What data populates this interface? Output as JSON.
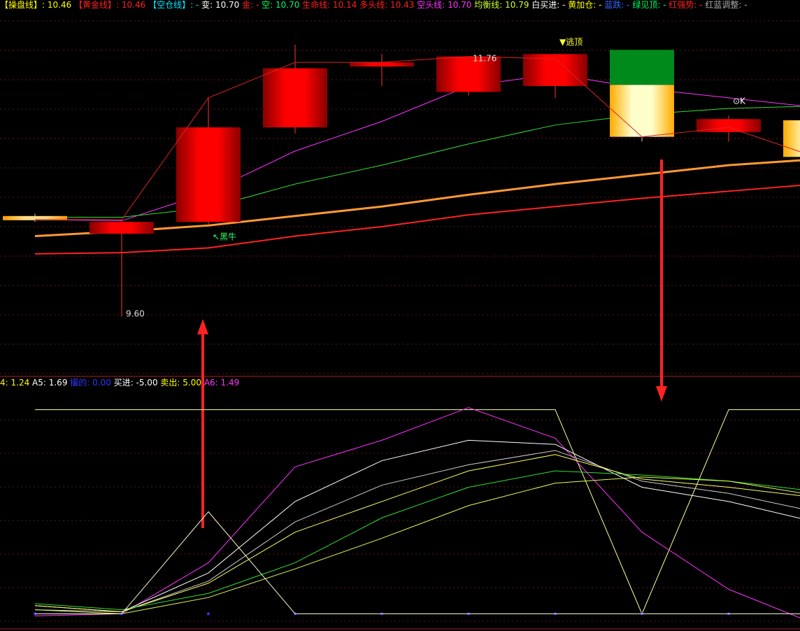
{
  "top_legend": [
    {
      "text": "【操盘线】: 10.46",
      "color": "#ffff00"
    },
    {
      "text": " 【黄金线】: 10.46",
      "color": "#ff2020"
    },
    {
      "text": " 【空仓线】: -",
      "color": "#00e5ff"
    },
    {
      "text": " 变: 10.70",
      "color": "#ffffff"
    },
    {
      "text": " 金: -",
      "color": "#ff2020"
    },
    {
      "text": " 空: 10.70",
      "color": "#00ff66"
    },
    {
      "text": "  生命线: 10.14",
      "color": "#ff2020"
    },
    {
      "text": "  多头线: 10.43",
      "color": "#ff2020"
    },
    {
      "text": " 空头线: 10.70",
      "color": "#ff33ff"
    },
    {
      "text": " 均衡线: 10.79",
      "color": "#ccff33"
    },
    {
      "text": "    白买进: -",
      "color": "#ffffff"
    },
    {
      "text": " 黄加仓: -",
      "color": "#ffff00"
    },
    {
      "text": " 蓝跌: -",
      "color": "#3366ff"
    },
    {
      "text": " 绿见顶: -",
      "color": "#00ff66"
    },
    {
      "text": " 红强势: -",
      "color": "#ff2020"
    },
    {
      "text": " 红蓝调整: -",
      "color": "#aaaaaa"
    }
  ],
  "bottom_legend": [
    {
      "text": "4: 1.24",
      "color": "#ffff00"
    },
    {
      "text": "  A5: 1.69",
      "color": "#ffffff"
    },
    {
      "text": "  撮的: 0.00",
      "color": "#3333ff"
    },
    {
      "text": "  买进: -5.00",
      "color": "#ffffff"
    },
    {
      "text": "  卖出: 5.00",
      "color": "#ffff00"
    },
    {
      "text": "  A6: 1.49",
      "color": "#ff33ff"
    }
  ],
  "chart_data": [
    {
      "type": "candlestick",
      "panel": "price",
      "ylim": [
        9.2,
        12.1
      ],
      "x_count": 10,
      "candles": [
        {
          "open": 10.45,
          "close": 10.42,
          "high": 10.47,
          "low": 10.4,
          "color": "#ffcc33"
        },
        {
          "open": 10.4,
          "close": 10.3,
          "high": 10.42,
          "low": 9.6,
          "color": "#ff0000"
        },
        {
          "open": 10.4,
          "close": 11.2,
          "high": 11.45,
          "low": 10.38,
          "color": "#ff0000"
        },
        {
          "open": 11.2,
          "close": 11.7,
          "high": 11.9,
          "low": 11.15,
          "color": "#ff0000"
        },
        {
          "open": 11.72,
          "close": 11.75,
          "high": 11.82,
          "low": 11.55,
          "color": "#ff0000"
        },
        {
          "open": 11.5,
          "close": 11.8,
          "high": 11.76,
          "low": 11.47,
          "color": "#ff0000"
        },
        {
          "open": 11.82,
          "close": 11.55,
          "high": 11.82,
          "low": 11.45,
          "color": "#ff0000"
        },
        {
          "open": 11.56,
          "close": 11.12,
          "high": 11.82,
          "low": 11.08,
          "color": "#ffee55",
          "top_color": "#008a1c"
        },
        {
          "open": 11.27,
          "close": 11.16,
          "high": 11.3,
          "low": 11.08,
          "color": "#ff0000"
        },
        {
          "open": 11.26,
          "close": 10.95,
          "high": 11.26,
          "low": 10.9,
          "color": "#ffee55"
        }
      ],
      "lines": [
        {
          "name": "magenta",
          "color": "#ff33ff",
          "values": [
            10.42,
            10.41,
            10.65,
            11.0,
            11.25,
            11.55,
            11.65,
            11.53,
            11.45,
            11.37
          ]
        },
        {
          "name": "green",
          "color": "#33dd33",
          "values": [
            10.44,
            10.44,
            10.52,
            10.72,
            10.88,
            11.06,
            11.22,
            11.31,
            11.36,
            11.38
          ]
        },
        {
          "name": "orange",
          "color": "#ff9933",
          "values": [
            10.28,
            10.32,
            10.37,
            10.45,
            10.53,
            10.63,
            10.72,
            10.8,
            10.88,
            10.93
          ]
        },
        {
          "name": "red",
          "color": "#ff2222",
          "values": [
            10.13,
            10.14,
            10.18,
            10.28,
            10.36,
            10.46,
            10.53,
            10.6,
            10.66,
            10.72
          ]
        },
        {
          "name": "close-link",
          "color": "#dd2222",
          "values": [
            10.42,
            10.42,
            11.45,
            11.75,
            11.75,
            11.8,
            11.78,
            11.12,
            11.2,
            10.95
          ]
        }
      ],
      "annotations": [
        {
          "text": "11.76",
          "index": 5,
          "value": 11.76,
          "color": "#dddddd"
        },
        {
          "text": "9.60",
          "index": 1,
          "value": 9.6,
          "color": "#dddddd"
        },
        {
          "text": "▼逃顶",
          "index": 6,
          "value": 11.9,
          "color": "#ffff33"
        },
        {
          "text": "↖黑牛",
          "index": 2,
          "value": 10.25,
          "color": "#33ff66"
        },
        {
          "text": "⊙K",
          "index": 8,
          "value": 11.4,
          "color": "#ffffff"
        }
      ],
      "arrows": [
        {
          "index": 2,
          "direction": "up",
          "color": "#ff2222"
        },
        {
          "index": 7,
          "direction": "down",
          "color": "#ff2222"
        }
      ]
    },
    {
      "type": "line",
      "panel": "indicator",
      "ylim": [
        -5.5,
        5.5
      ],
      "series": [
        {
          "name": "买进",
          "color": "#ffff99",
          "values": [
            5.0,
            5.0,
            5.0,
            5.0,
            5.0,
            5.0,
            5.0,
            -5.0,
            5.0,
            5.0
          ]
        },
        {
          "name": "magenta-line",
          "color": "#ff33ff",
          "values": [
            -5.1,
            -5.0,
            -2.5,
            2.2,
            3.5,
            5.1,
            3.6,
            -1.0,
            -3.8,
            -5.5
          ]
        },
        {
          "name": "white-a",
          "color": "#ffffff",
          "values": [
            -4.6,
            -4.9,
            -3.0,
            0.5,
            2.5,
            3.5,
            3.3,
            1.2,
            0.5,
            -0.5
          ]
        },
        {
          "name": "white-b",
          "color": "#cccccc",
          "values": [
            -4.8,
            -4.9,
            -3.4,
            -0.5,
            1.3,
            2.3,
            3.0,
            1.5,
            0.9,
            0.0
          ]
        },
        {
          "name": "yellow-line",
          "color": "#ffff66",
          "values": [
            -4.6,
            -4.9,
            -3.5,
            -1.0,
            0.5,
            2.0,
            2.8,
            1.6,
            1.2,
            0.7
          ]
        },
        {
          "name": "green-line",
          "color": "#33dd33",
          "values": [
            -4.5,
            -4.8,
            -4.0,
            -2.5,
            -0.3,
            1.2,
            2.0,
            1.8,
            1.5,
            1.0
          ]
        },
        {
          "name": "yellow-low",
          "color": "#ddff55",
          "values": [
            -4.8,
            -5.0,
            -4.2,
            -2.8,
            -1.3,
            0.3,
            1.4,
            1.7,
            1.5,
            0.8
          ]
        },
        {
          "name": "撮的",
          "color": "#3333ff",
          "values": [
            -5.0,
            -5.0,
            -5.0,
            -5.0,
            -5.0,
            -5.0,
            -5.0,
            -5.0,
            -5.0,
            -5.0
          ]
        },
        {
          "name": "卖出",
          "color": "#ffffcc",
          "values": [
            -5.0,
            -5.0,
            0.0,
            -5.0,
            -5.0,
            -5.0,
            -5.0,
            -5.0,
            -5.0,
            -5.0
          ]
        }
      ]
    }
  ]
}
